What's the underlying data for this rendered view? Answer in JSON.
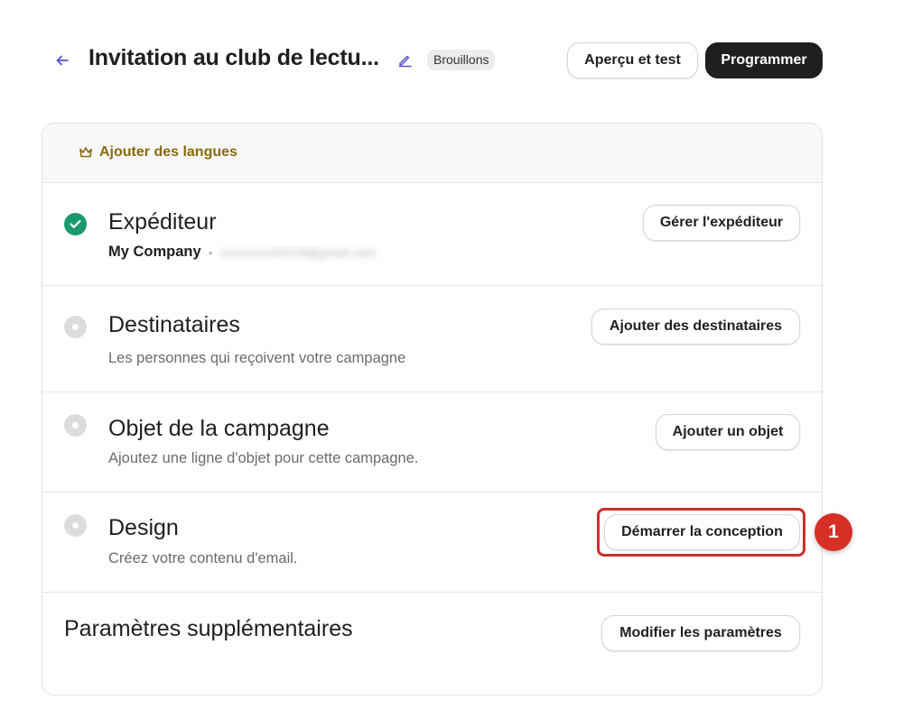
{
  "header": {
    "back_icon": "arrow-left-icon",
    "title": "Invitation au club de lectu...",
    "edit_icon": "pencil-icon",
    "status_badge": "Brouillons",
    "preview_label": "Aperçu et test",
    "schedule_label": "Programmer"
  },
  "languages": {
    "icon": "crown-icon",
    "label": "Ajouter des langues"
  },
  "sections": [
    {
      "status": "done",
      "title": "Expéditeur",
      "sender_name": "My Company",
      "sender_email": "xxxxxxxx00019@gmail.com",
      "button_label": "Gérer l'expéditeur"
    },
    {
      "status": "pending",
      "title": "Destinataires",
      "description": "Les personnes qui reçoivent votre campagne",
      "button_label": "Ajouter des destinataires"
    },
    {
      "status": "pending",
      "title": "Objet de la campagne",
      "description": "Ajoutez une ligne d'objet pour cette campagne.",
      "button_label": "Ajouter un objet"
    },
    {
      "status": "pending",
      "title": "Design",
      "description": "Créez votre contenu d'email.",
      "button_label": "Démarrer la conception"
    },
    {
      "title": "Paramètres supplémentaires",
      "button_label": "Modifier les paramètres"
    }
  ],
  "annotation": {
    "step_number": "1",
    "color": "#d62f26"
  },
  "colors": {
    "accent_purple": "#5b4fcf",
    "done_green": "#1a9a6c",
    "gold": "#8a6a0a",
    "dark_button": "#1f1f1f"
  }
}
